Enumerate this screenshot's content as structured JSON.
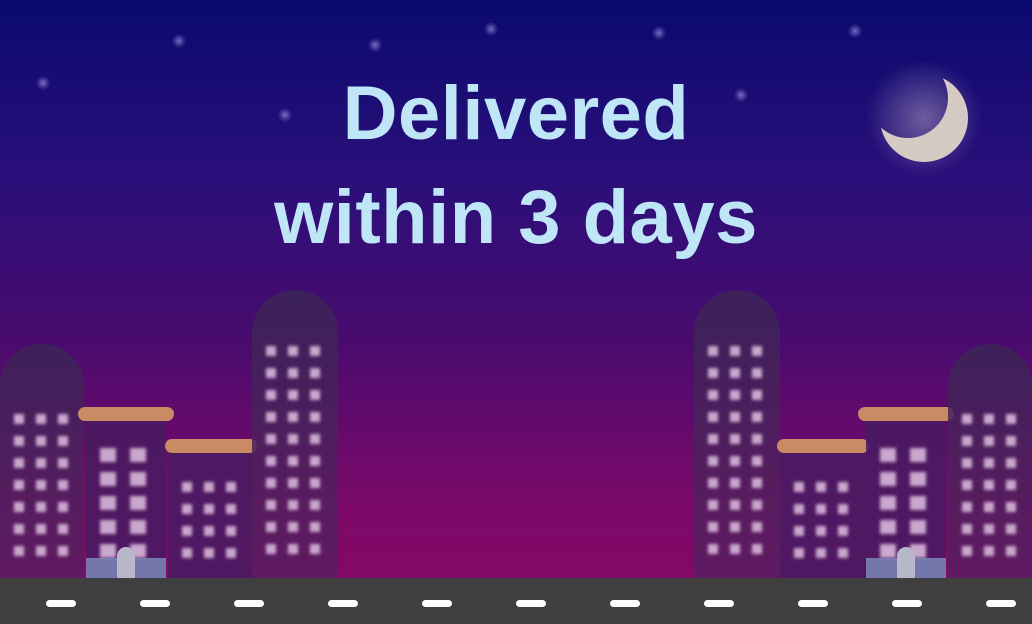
{
  "headline": {
    "line1": "Delivered",
    "line2": "within 3 days"
  },
  "colors": {
    "sky_top": "#0a0a6e",
    "sky_bottom": "#8a0866",
    "headline": "#bfe6f7",
    "moon": "#d6cac4",
    "building": "#3d1a5a",
    "window": "#d7b8d9",
    "roof_trim": "#c98a64",
    "road": "#3f3f3f",
    "road_marking": "#ffffff"
  },
  "icons": [
    "crescent-moon-icon",
    "star-icon",
    "building-icon"
  ]
}
